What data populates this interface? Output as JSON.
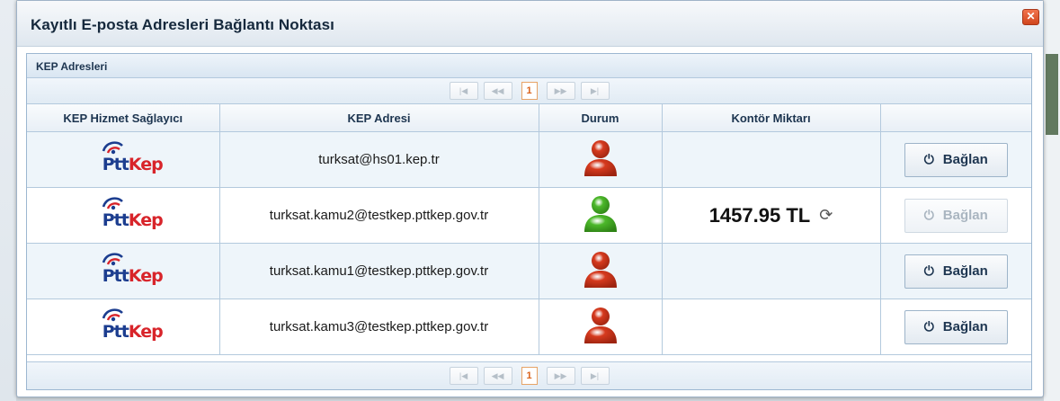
{
  "dialog": {
    "title": "Kayıtlı E-posta Adresleri Bağlantı Noktası",
    "close_icon": "close-icon"
  },
  "panel": {
    "title": "KEP Adresleri"
  },
  "pager": {
    "first": "|◀",
    "prev": "◀◀",
    "page": "1",
    "next": "▶▶",
    "last": "▶|"
  },
  "columns": [
    "KEP Hizmet Sağlayıcı",
    "KEP Adresi",
    "Durum",
    "Kontör Miktarı",
    ""
  ],
  "logo": {
    "ptt": "Ptt",
    "kep": "Kep"
  },
  "rows": [
    {
      "address": "turksat@hs01.kep.tr",
      "status": "offline",
      "credit": "",
      "button": "Bağlan",
      "enabled": true
    },
    {
      "address": "turksat.kamu2@testkep.pttkep.gov.tr",
      "status": "online",
      "credit": "1457.95 TL",
      "button": "Bağlan",
      "enabled": false
    },
    {
      "address": "turksat.kamu1@testkep.pttkep.gov.tr",
      "status": "offline",
      "credit": "",
      "button": "Bağlan",
      "enabled": true
    },
    {
      "address": "turksat.kamu3@testkep.pttkep.gov.tr",
      "status": "offline",
      "credit": "",
      "button": "Bağlan",
      "enabled": true
    }
  ],
  "colors": {
    "online": "#4cb82a",
    "offline": "#d63a1e",
    "accent": "#d9611a"
  }
}
